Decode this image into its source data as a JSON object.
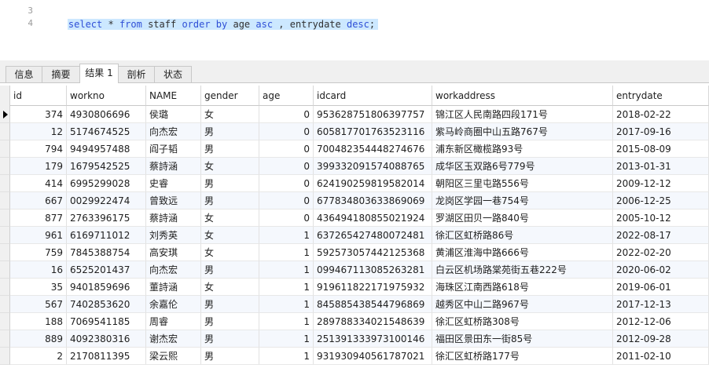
{
  "editor": {
    "line_numbers": [
      "3",
      "4"
    ],
    "sql_tokens": [
      {
        "t": "select",
        "c": "kw"
      },
      {
        "t": " * ",
        "c": "pn"
      },
      {
        "t": "from",
        "c": "kw"
      },
      {
        "t": " staff ",
        "c": "id"
      },
      {
        "t": "order",
        "c": "kw"
      },
      {
        "t": " ",
        "c": "pn"
      },
      {
        "t": "by",
        "c": "kw"
      },
      {
        "t": " age ",
        "c": "id"
      },
      {
        "t": "asc",
        "c": "kw"
      },
      {
        "t": " , entrydate ",
        "c": "id"
      },
      {
        "t": "desc",
        "c": "kw"
      },
      {
        "t": ";",
        "c": "pn"
      }
    ]
  },
  "tabs": [
    "信息",
    "摘要",
    "结果 1",
    "剖析",
    "状态"
  ],
  "active_tab": 2,
  "columns": [
    "id",
    "workno",
    "NAME",
    "gender",
    "age",
    "idcard",
    "workaddress",
    "entrydate"
  ],
  "rows": [
    [
      "374",
      "4930806696",
      "侯璐",
      "女",
      "0",
      "953628751806397757",
      "锦江区人民南路四段171号",
      "2018-02-22"
    ],
    [
      "12",
      "5174674525",
      "向杰宏",
      "男",
      "0",
      "605817701763523116",
      "紫马岭商圈中山五路767号",
      "2017-09-16"
    ],
    [
      "794",
      "9494957488",
      "阎子韬",
      "男",
      "0",
      "700482354448274676",
      "浦东新区橄榄路93号",
      "2015-08-09"
    ],
    [
      "179",
      "1679542525",
      "蔡詩涵",
      "女",
      "0",
      "399332091574088765",
      "成华区玉双路6号779号",
      "2013-01-31"
    ],
    [
      "414",
      "6995299028",
      "史睿",
      "男",
      "0",
      "624190259819582014",
      "朝阳区三里屯路556号",
      "2009-12-12"
    ],
    [
      "667",
      "0029922474",
      "曾致远",
      "男",
      "0",
      "677834803633869069",
      "龙岗区学园一巷754号",
      "2006-12-25"
    ],
    [
      "877",
      "2763396175",
      "蔡詩涵",
      "女",
      "0",
      "436494180855021924",
      "罗湖区田贝一路840号",
      "2005-10-12"
    ],
    [
      "961",
      "6169711012",
      "刘秀英",
      "女",
      "1",
      "637265427480072481",
      "徐汇区虹桥路86号",
      "2022-08-17"
    ],
    [
      "759",
      "7845388754",
      "高安琪",
      "女",
      "1",
      "592573057442125368",
      "黄浦区淮海中路666号",
      "2022-02-20"
    ],
    [
      "16",
      "6525201437",
      "向杰宏",
      "男",
      "1",
      "099467113085263281",
      "白云区机场路棠苑街五巷222号",
      "2020-06-02"
    ],
    [
      "35",
      "9401859696",
      "董詩涵",
      "女",
      "1",
      "919611822171975932",
      "海珠区江南西路618号",
      "2019-06-01"
    ],
    [
      "567",
      "7402853620",
      "余嘉伦",
      "男",
      "1",
      "845885438544796869",
      "越秀区中山二路967号",
      "2017-12-13"
    ],
    [
      "188",
      "7069541185",
      "周睿",
      "男",
      "1",
      "289788334021548639",
      "徐汇区虹桥路308号",
      "2012-12-06"
    ],
    [
      "889",
      "4092380316",
      "谢杰宏",
      "男",
      "1",
      "251391333973100146",
      "福田区景田东一街85号",
      "2012-09-28"
    ],
    [
      "2",
      "2170811395",
      "梁云熙",
      "男",
      "1",
      "931930940561787021",
      "徐汇区虹桥路177号",
      "2011-02-10"
    ]
  ]
}
